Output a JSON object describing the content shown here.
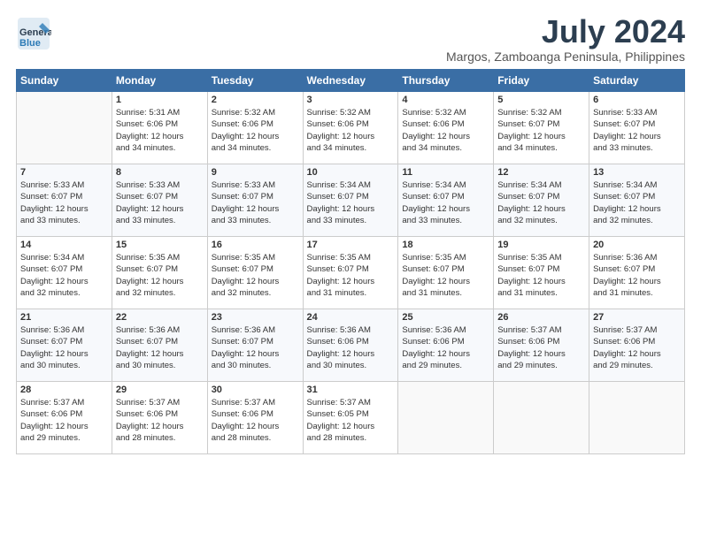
{
  "logo": {
    "general": "General",
    "blue": "Blue"
  },
  "header": {
    "month_title": "July 2024",
    "subtitle": "Margos, Zamboanga Peninsula, Philippines"
  },
  "days_of_week": [
    "Sunday",
    "Monday",
    "Tuesday",
    "Wednesday",
    "Thursday",
    "Friday",
    "Saturday"
  ],
  "weeks": [
    [
      {
        "day": "",
        "info": ""
      },
      {
        "day": "1",
        "info": "Sunrise: 5:31 AM\nSunset: 6:06 PM\nDaylight: 12 hours\nand 34 minutes."
      },
      {
        "day": "2",
        "info": "Sunrise: 5:32 AM\nSunset: 6:06 PM\nDaylight: 12 hours\nand 34 minutes."
      },
      {
        "day": "3",
        "info": "Sunrise: 5:32 AM\nSunset: 6:06 PM\nDaylight: 12 hours\nand 34 minutes."
      },
      {
        "day": "4",
        "info": "Sunrise: 5:32 AM\nSunset: 6:06 PM\nDaylight: 12 hours\nand 34 minutes."
      },
      {
        "day": "5",
        "info": "Sunrise: 5:32 AM\nSunset: 6:07 PM\nDaylight: 12 hours\nand 34 minutes."
      },
      {
        "day": "6",
        "info": "Sunrise: 5:33 AM\nSunset: 6:07 PM\nDaylight: 12 hours\nand 33 minutes."
      }
    ],
    [
      {
        "day": "7",
        "info": "Sunrise: 5:33 AM\nSunset: 6:07 PM\nDaylight: 12 hours\nand 33 minutes."
      },
      {
        "day": "8",
        "info": "Sunrise: 5:33 AM\nSunset: 6:07 PM\nDaylight: 12 hours\nand 33 minutes."
      },
      {
        "day": "9",
        "info": "Sunrise: 5:33 AM\nSunset: 6:07 PM\nDaylight: 12 hours\nand 33 minutes."
      },
      {
        "day": "10",
        "info": "Sunrise: 5:34 AM\nSunset: 6:07 PM\nDaylight: 12 hours\nand 33 minutes."
      },
      {
        "day": "11",
        "info": "Sunrise: 5:34 AM\nSunset: 6:07 PM\nDaylight: 12 hours\nand 33 minutes."
      },
      {
        "day": "12",
        "info": "Sunrise: 5:34 AM\nSunset: 6:07 PM\nDaylight: 12 hours\nand 32 minutes."
      },
      {
        "day": "13",
        "info": "Sunrise: 5:34 AM\nSunset: 6:07 PM\nDaylight: 12 hours\nand 32 minutes."
      }
    ],
    [
      {
        "day": "14",
        "info": "Sunrise: 5:34 AM\nSunset: 6:07 PM\nDaylight: 12 hours\nand 32 minutes."
      },
      {
        "day": "15",
        "info": "Sunrise: 5:35 AM\nSunset: 6:07 PM\nDaylight: 12 hours\nand 32 minutes."
      },
      {
        "day": "16",
        "info": "Sunrise: 5:35 AM\nSunset: 6:07 PM\nDaylight: 12 hours\nand 32 minutes."
      },
      {
        "day": "17",
        "info": "Sunrise: 5:35 AM\nSunset: 6:07 PM\nDaylight: 12 hours\nand 31 minutes."
      },
      {
        "day": "18",
        "info": "Sunrise: 5:35 AM\nSunset: 6:07 PM\nDaylight: 12 hours\nand 31 minutes."
      },
      {
        "day": "19",
        "info": "Sunrise: 5:35 AM\nSunset: 6:07 PM\nDaylight: 12 hours\nand 31 minutes."
      },
      {
        "day": "20",
        "info": "Sunrise: 5:36 AM\nSunset: 6:07 PM\nDaylight: 12 hours\nand 31 minutes."
      }
    ],
    [
      {
        "day": "21",
        "info": "Sunrise: 5:36 AM\nSunset: 6:07 PM\nDaylight: 12 hours\nand 30 minutes."
      },
      {
        "day": "22",
        "info": "Sunrise: 5:36 AM\nSunset: 6:07 PM\nDaylight: 12 hours\nand 30 minutes."
      },
      {
        "day": "23",
        "info": "Sunrise: 5:36 AM\nSunset: 6:07 PM\nDaylight: 12 hours\nand 30 minutes."
      },
      {
        "day": "24",
        "info": "Sunrise: 5:36 AM\nSunset: 6:06 PM\nDaylight: 12 hours\nand 30 minutes."
      },
      {
        "day": "25",
        "info": "Sunrise: 5:36 AM\nSunset: 6:06 PM\nDaylight: 12 hours\nand 29 minutes."
      },
      {
        "day": "26",
        "info": "Sunrise: 5:37 AM\nSunset: 6:06 PM\nDaylight: 12 hours\nand 29 minutes."
      },
      {
        "day": "27",
        "info": "Sunrise: 5:37 AM\nSunset: 6:06 PM\nDaylight: 12 hours\nand 29 minutes."
      }
    ],
    [
      {
        "day": "28",
        "info": "Sunrise: 5:37 AM\nSunset: 6:06 PM\nDaylight: 12 hours\nand 29 minutes."
      },
      {
        "day": "29",
        "info": "Sunrise: 5:37 AM\nSunset: 6:06 PM\nDaylight: 12 hours\nand 28 minutes."
      },
      {
        "day": "30",
        "info": "Sunrise: 5:37 AM\nSunset: 6:06 PM\nDaylight: 12 hours\nand 28 minutes."
      },
      {
        "day": "31",
        "info": "Sunrise: 5:37 AM\nSunset: 6:05 PM\nDaylight: 12 hours\nand 28 minutes."
      },
      {
        "day": "",
        "info": ""
      },
      {
        "day": "",
        "info": ""
      },
      {
        "day": "",
        "info": ""
      }
    ]
  ]
}
